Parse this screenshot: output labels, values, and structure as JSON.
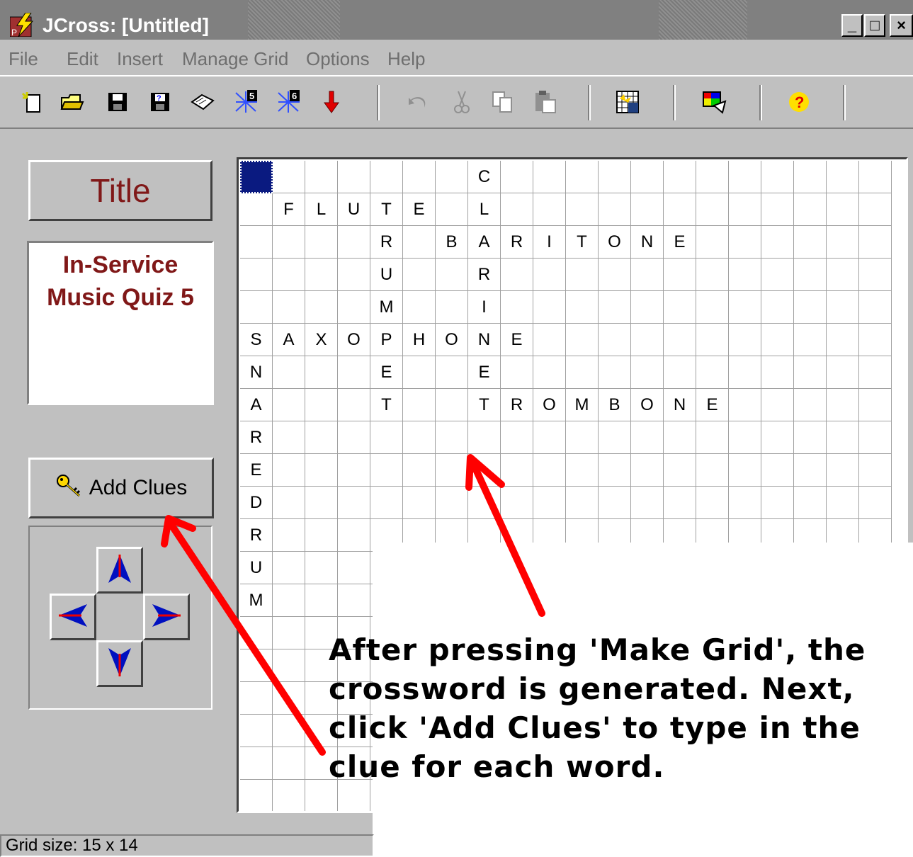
{
  "window": {
    "title": "JCross: [Untitled]",
    "controls": [
      "_",
      "□",
      "×"
    ]
  },
  "menu": [
    {
      "label": "File"
    },
    {
      "label": "Edit"
    },
    {
      "label": "Insert"
    },
    {
      "label": "Manage Grid"
    },
    {
      "label": "Options"
    },
    {
      "label": "Help"
    }
  ],
  "toolbar": {
    "groups": [
      [
        "new-file-icon",
        "open-folder-icon",
        "save-icon",
        "save-as-icon",
        "webpage-icon",
        "export-v5-icon",
        "export-v6-icon",
        "down-arrow-icon"
      ],
      [
        "undo-icon",
        "cut-icon",
        "copy-icon",
        "paste-icon"
      ],
      [
        "make-grid-icon"
      ],
      [
        "settings-icon"
      ],
      [
        "help-icon"
      ]
    ]
  },
  "left_panel": {
    "title_button": "Title",
    "quiz_title": "In-Service\nMusic Quiz 5",
    "add_clues_button": "Add Clues",
    "arrow_pad": [
      "up-arrow-icon",
      "left-arrow-icon",
      "right-arrow-icon",
      "down-arrow-icon"
    ]
  },
  "grid": {
    "rows": [
      [
        "",
        "",
        "",
        "",
        "",
        "",
        "",
        "C",
        "",
        "",
        "",
        "",
        "",
        "",
        "",
        "",
        "",
        "",
        "",
        ""
      ],
      [
        "",
        "F",
        "L",
        "U",
        "T",
        "E",
        "",
        "L",
        "",
        "",
        "",
        "",
        "",
        "",
        "",
        "",
        "",
        "",
        "",
        ""
      ],
      [
        "",
        "",
        "",
        "",
        "R",
        "",
        "B",
        "A",
        "R",
        "I",
        "T",
        "O",
        "N",
        "E",
        "",
        "",
        "",
        "",
        "",
        ""
      ],
      [
        "",
        "",
        "",
        "",
        "U",
        "",
        "",
        "R",
        "",
        "",
        "",
        "",
        "",
        "",
        "",
        "",
        "",
        "",
        "",
        ""
      ],
      [
        "",
        "",
        "",
        "",
        "M",
        "",
        "",
        "I",
        "",
        "",
        "",
        "",
        "",
        "",
        "",
        "",
        "",
        "",
        "",
        ""
      ],
      [
        "S",
        "A",
        "X",
        "O",
        "P",
        "H",
        "O",
        "N",
        "E",
        "",
        "",
        "",
        "",
        "",
        "",
        "",
        "",
        "",
        "",
        ""
      ],
      [
        "N",
        "",
        "",
        "",
        "E",
        "",
        "",
        "E",
        "",
        "",
        "",
        "",
        "",
        "",
        "",
        "",
        "",
        "",
        "",
        ""
      ],
      [
        "A",
        "",
        "",
        "",
        "T",
        "",
        "",
        "T",
        "R",
        "O",
        "M",
        "B",
        "O",
        "N",
        "E",
        "",
        "",
        "",
        "",
        ""
      ],
      [
        "R",
        "",
        "",
        "",
        "",
        "",
        "",
        "",
        "",
        "",
        "",
        "",
        "",
        "",
        "",
        "",
        "",
        "",
        "",
        ""
      ],
      [
        "E",
        "",
        "",
        "",
        "",
        "",
        "",
        "",
        "",
        "",
        "",
        "",
        "",
        "",
        "",
        "",
        "",
        "",
        "",
        ""
      ],
      [
        "D",
        "",
        "",
        "",
        "",
        "",
        "",
        "",
        "",
        "",
        "",
        "",
        "",
        "",
        "",
        "",
        "",
        "",
        "",
        ""
      ],
      [
        "R",
        "",
        "",
        "",
        "",
        "",
        "",
        "",
        "",
        "",
        "",
        "",
        "",
        "",
        "",
        "",
        "",
        "",
        "",
        ""
      ],
      [
        "U",
        "",
        "",
        "",
        "",
        "",
        "",
        "",
        "",
        "",
        "",
        "",
        "",
        "",
        "",
        "",
        "",
        "",
        "",
        ""
      ],
      [
        "M",
        "",
        "",
        "",
        "",
        "",
        "",
        "",
        "",
        "",
        "",
        "",
        "",
        "",
        "",
        "",
        "",
        "",
        "",
        ""
      ],
      [
        "",
        "",
        "",
        "",
        "",
        "",
        "",
        "",
        "",
        "",
        "",
        "",
        "",
        "",
        "",
        "",
        "",
        "",
        "",
        ""
      ],
      [
        "",
        "",
        "",
        "",
        "",
        "",
        "",
        "",
        "",
        "",
        "",
        "",
        "",
        "",
        "",
        "",
        "",
        "",
        "",
        ""
      ],
      [
        "",
        "",
        "",
        "",
        "",
        "",
        "",
        "",
        "",
        "",
        "",
        "",
        "",
        "",
        "",
        "",
        "",
        "",
        "",
        ""
      ],
      [
        "",
        "",
        "",
        "",
        "",
        "",
        "",
        "",
        "",
        "",
        "",
        "",
        "",
        "",
        "",
        "",
        "",
        "",
        "",
        ""
      ],
      [
        "",
        "",
        "",
        "",
        "",
        "",
        "",
        "",
        "",
        "",
        "",
        "",
        "",
        "",
        "",
        "",
        "",
        "",
        "",
        ""
      ],
      [
        "",
        "",
        "",
        "",
        "",
        "",
        "",
        "",
        "",
        "",
        "",
        "",
        "",
        "",
        "",
        "",
        "",
        "",
        "",
        ""
      ]
    ],
    "selected_cell": [
      0,
      0
    ]
  },
  "annotation": {
    "text": "After pressing 'Make Grid', the crossword is generated. Next, click 'Add Clues' to type in the clue for each word.",
    "arrow_color": "#ff0000"
  },
  "status_bar": {
    "text": "Grid size: 15 x 14"
  },
  "colors": {
    "title_red": "#801818",
    "selected_cell": "#0a1a80",
    "face": "#c0c0c0"
  }
}
